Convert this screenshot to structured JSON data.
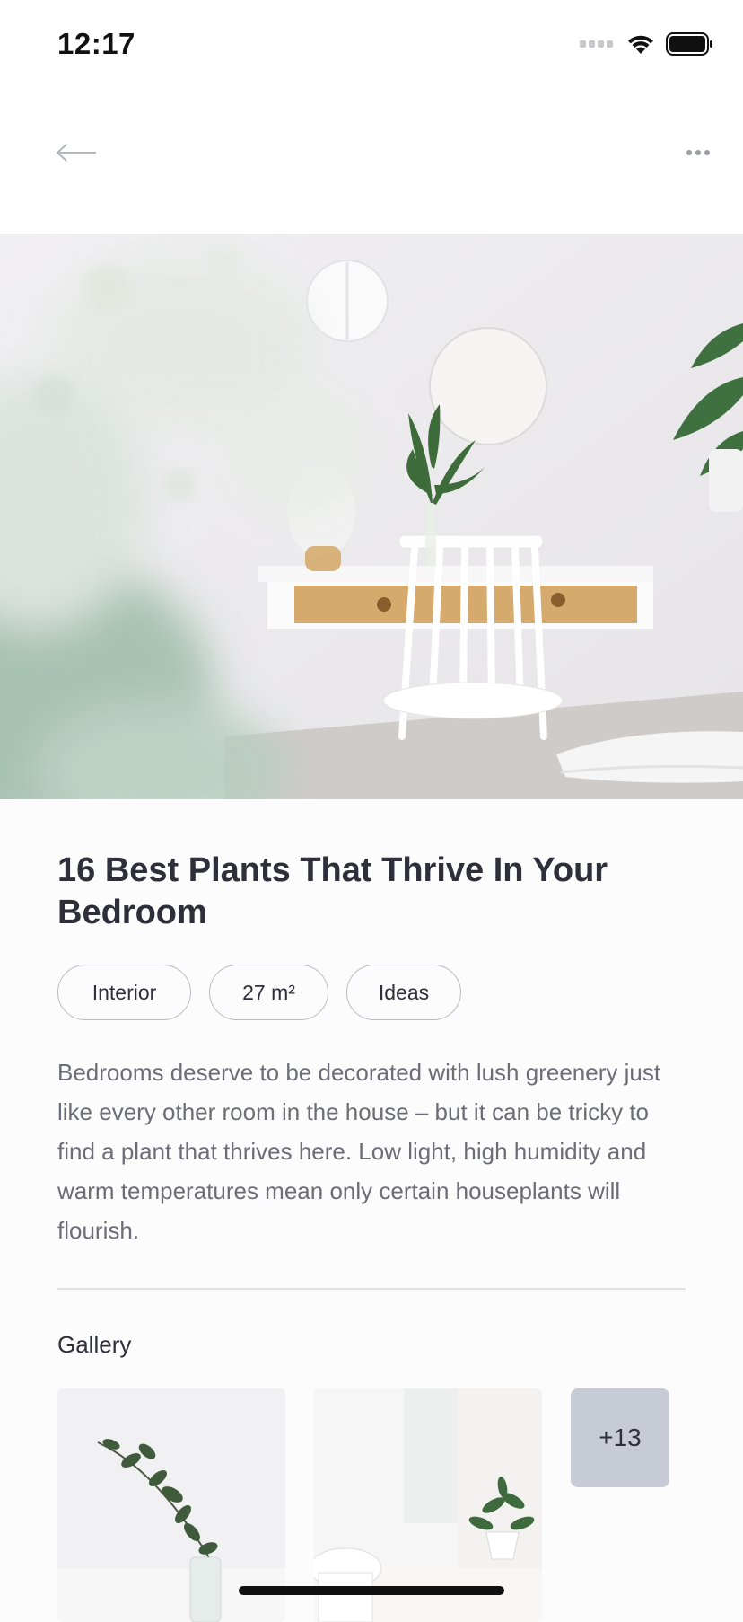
{
  "status_bar": {
    "time": "12:17"
  },
  "nav": {
    "back_icon": "arrow-left-icon",
    "more_icon": "ellipsis-icon"
  },
  "article": {
    "title": "16 Best Plants That Thrive In Your Bedroom",
    "tags": [
      "Interior",
      "27 m²",
      "Ideas"
    ],
    "body": "Bedrooms deserve to be decorated with lush greenery just like every other room in the house – but it can be tricky to find a plant that thrives here. Low light, high humidity and warm temperatures mean only certain houseplants will flourish."
  },
  "gallery": {
    "title": "Gallery",
    "more_count": "+13"
  },
  "colors": {
    "text_primary": "#2e2f3a",
    "text_secondary": "#6c6d76",
    "tag_border": "#b9bac3",
    "more_badge": "#c7cbd5"
  }
}
